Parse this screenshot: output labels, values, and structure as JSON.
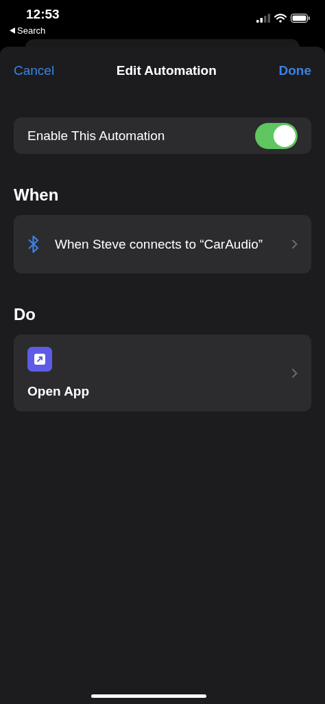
{
  "status_bar": {
    "time": "12:53",
    "back_label": "Search"
  },
  "nav": {
    "cancel": "Cancel",
    "title": "Edit Automation",
    "done": "Done"
  },
  "enable": {
    "label": "Enable This Automation",
    "on": true
  },
  "sections": [
    {
      "title": "When",
      "items": [
        {
          "kind": "trigger",
          "text": "When Steve connects to “CarAudio”"
        }
      ]
    },
    {
      "title": "Do",
      "items": [
        {
          "kind": "action",
          "text": "Open App"
        }
      ]
    }
  ]
}
